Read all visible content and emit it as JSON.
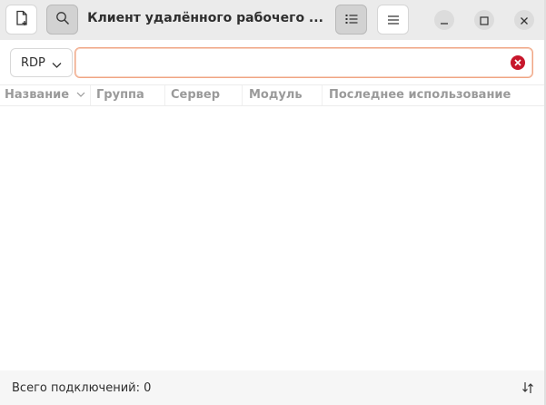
{
  "header": {
    "title": "Клиент удалённого рабочего ...",
    "new_connection_icon": "new-document-icon",
    "search_icon": "search-icon",
    "view_toggle_icon": "list-view-icon",
    "menu_icon": "hamburger-menu-icon"
  },
  "window_controls": {
    "minimize_icon": "minimize-icon",
    "maximize_icon": "maximize-icon",
    "close_icon": "close-icon"
  },
  "toolbar": {
    "protocol_value": "RDP",
    "search_value": "",
    "clear_icon": "clear-icon"
  },
  "columns": [
    {
      "label": "Название"
    },
    {
      "label": "Группа"
    },
    {
      "label": "Сервер"
    },
    {
      "label": "Модуль"
    },
    {
      "label": "Последнее использование"
    }
  ],
  "status": {
    "text": "Всего подключений: 0",
    "icon": "sort-toggle-icon"
  },
  "colors": {
    "accent_focus": "#f0a583",
    "clear_icon": "#c7162b"
  }
}
